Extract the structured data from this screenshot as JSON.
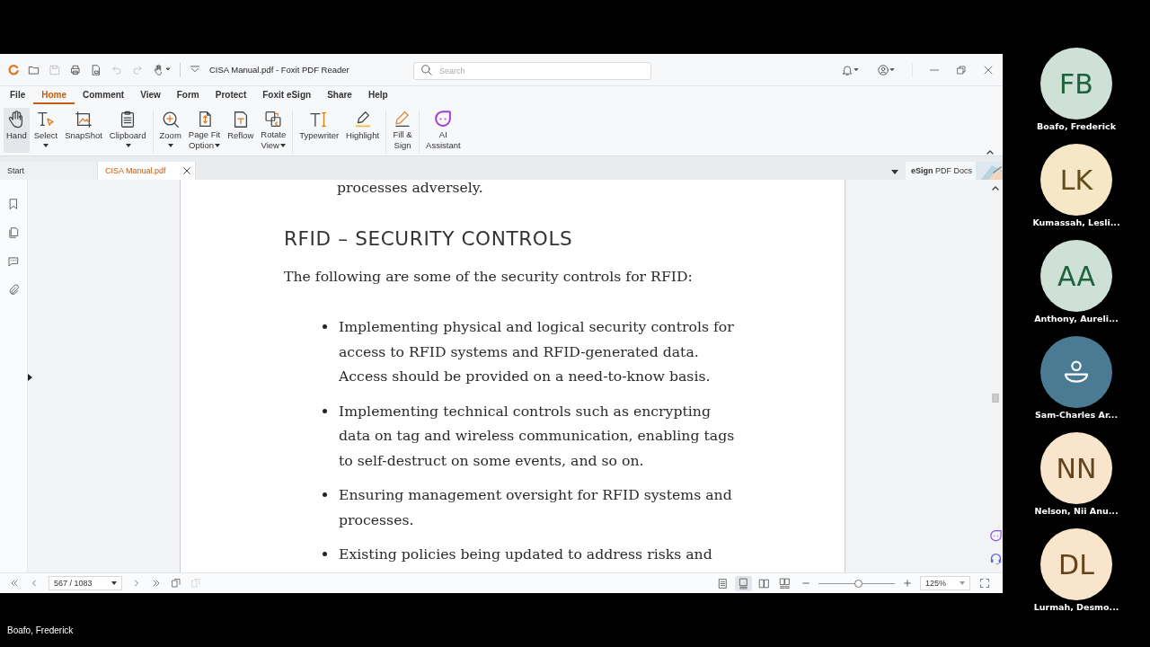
{
  "window": {
    "title": "CISA Manual.pdf - Foxit PDF Reader",
    "search_placeholder": "Search"
  },
  "menu_tabs": [
    {
      "label": "File",
      "selected": false
    },
    {
      "label": "Home",
      "selected": true
    },
    {
      "label": "Comment",
      "selected": false
    },
    {
      "label": "View",
      "selected": false
    },
    {
      "label": "Form",
      "selected": false
    },
    {
      "label": "Protect",
      "selected": false
    },
    {
      "label": "Foxit eSign",
      "selected": false
    },
    {
      "label": "Share",
      "selected": false
    },
    {
      "label": "Help",
      "selected": false
    }
  ],
  "ribbon_groups": [
    {
      "buttons": [
        {
          "label": "Hand",
          "selected": true,
          "dropdown": false
        },
        {
          "label": "Select",
          "selected": false,
          "dropdown": true
        },
        {
          "label": "SnapShot",
          "selected": false,
          "dropdown": false
        },
        {
          "label": "Clipboard",
          "selected": false,
          "dropdown": true
        }
      ]
    },
    {
      "buttons": [
        {
          "label": "Zoom",
          "selected": false,
          "dropdown": true
        },
        {
          "label": "Page Fit\nOption",
          "selected": false,
          "dropdown": true
        },
        {
          "label": "Reflow",
          "selected": false,
          "dropdown": false
        },
        {
          "label": "Rotate\nView",
          "selected": false,
          "dropdown": true
        }
      ]
    },
    {
      "buttons": [
        {
          "label": "Typewriter",
          "selected": false,
          "dropdown": false
        },
        {
          "label": "Highlight",
          "selected": false,
          "dropdown": false
        }
      ]
    },
    {
      "buttons": [
        {
          "label": "Fill &\nSign",
          "selected": false,
          "dropdown": false
        }
      ]
    },
    {
      "buttons": [
        {
          "label": "AI\nAssistant",
          "selected": false,
          "dropdown": false
        }
      ]
    }
  ],
  "doc_tabs": [
    {
      "label": "Start",
      "selected": false,
      "closable": false
    },
    {
      "label": "CISA Manual.pdf",
      "selected": true,
      "closable": true
    }
  ],
  "esign_banner": "**eSign** PDF Docs",
  "document": {
    "top_line": "processes adversely.",
    "heading": "RFID – SECURITY CONTROLS",
    "intro": "The following are some of the security controls for RFID:",
    "bullets": [
      "Implementing physical and logical security controls for access to RFID systems and RFID-generated data. Access should be provided on a need-to-know basis.",
      "Implementing technical controls such as encrypting data on tag and wireless communication, enabling tags to self-destruct on some events, and so on.",
      "Ensuring management oversight for RFID systems and processes.",
      "Existing policies being updated to address risks and"
    ]
  },
  "status_bar": {
    "page": "567 / 1083",
    "view_modes": [
      {
        "selected": false
      },
      {
        "selected": true
      },
      {
        "selected": false
      },
      {
        "selected": false
      }
    ],
    "zoom": {
      "level": 0.53,
      "value": "125%"
    }
  },
  "participants": [
    {
      "kind": "initials",
      "initials": "FB",
      "name": "Boafo, Frederick",
      "color": "#cfe0d7"
    },
    {
      "kind": "initials",
      "initials": "LK",
      "name": "Kumassah, Lesli...",
      "color": "#f6e7c6"
    },
    {
      "kind": "initials",
      "initials": "AA",
      "name": "Anthony, Aureli...",
      "color": "#cfe0d7"
    },
    {
      "kind": "silhouette",
      "name": "Sam-Charles Ar...",
      "color": "#4a7b93"
    },
    {
      "kind": "initials",
      "initials": "NN",
      "name": "Nelson, Nii Anu...",
      "color": "#f8e5cc"
    },
    {
      "kind": "initials",
      "initials": "DL",
      "name": "Lurmah, Desmo...",
      "color": "#f8e5cc"
    }
  ],
  "speaker_caption": "Boafo, Frederick"
}
